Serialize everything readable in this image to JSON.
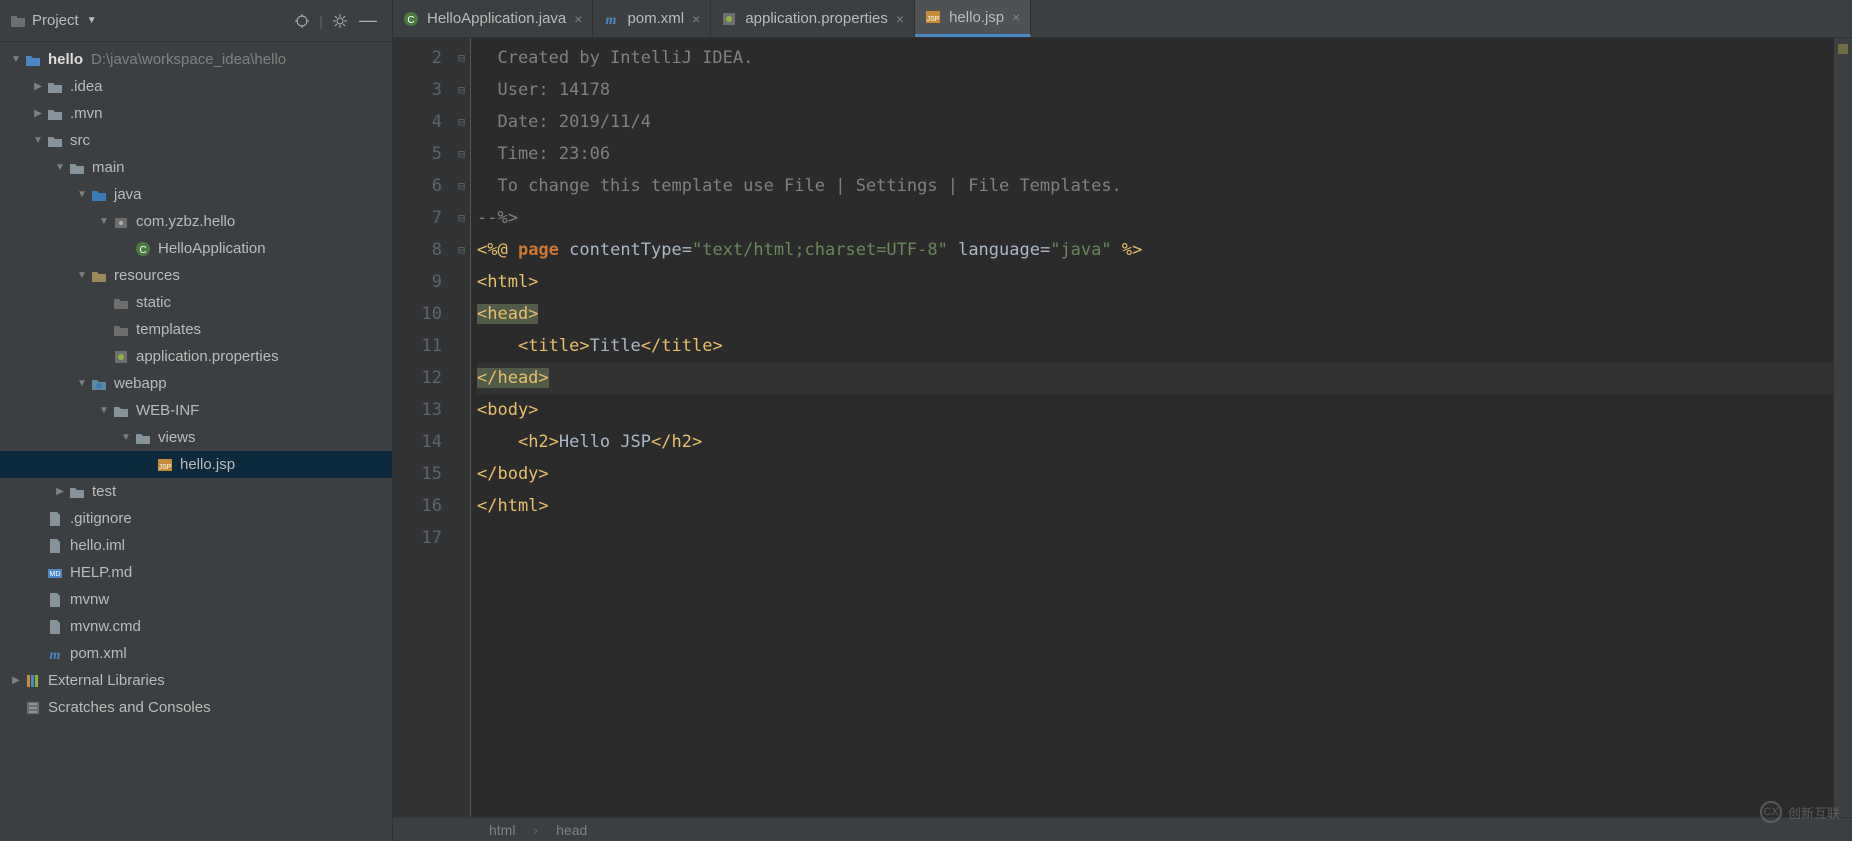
{
  "project": {
    "panel_label": "Project",
    "tree": [
      {
        "depth": 0,
        "arrow": "▼",
        "icon": "folder-blue",
        "label": "hello",
        "path": "D:\\java\\workspace_idea\\hello",
        "bold": true
      },
      {
        "depth": 1,
        "arrow": "▶",
        "icon": "folder",
        "label": ".idea"
      },
      {
        "depth": 1,
        "arrow": "▶",
        "icon": "folder",
        "label": ".mvn"
      },
      {
        "depth": 1,
        "arrow": "▼",
        "icon": "folder",
        "label": "src"
      },
      {
        "depth": 2,
        "arrow": "▼",
        "icon": "folder",
        "label": "main"
      },
      {
        "depth": 3,
        "arrow": "▼",
        "icon": "folder-src",
        "label": "java"
      },
      {
        "depth": 4,
        "arrow": "▼",
        "icon": "package",
        "label": "com.yzbz.hello"
      },
      {
        "depth": 5,
        "arrow": "",
        "icon": "class",
        "label": "HelloApplication"
      },
      {
        "depth": 3,
        "arrow": "▼",
        "icon": "folder-res",
        "label": "resources"
      },
      {
        "depth": 4,
        "arrow": "",
        "icon": "folder-grey",
        "label": "static"
      },
      {
        "depth": 4,
        "arrow": "",
        "icon": "folder-grey",
        "label": "templates"
      },
      {
        "depth": 4,
        "arrow": "",
        "icon": "props",
        "label": "application.properties"
      },
      {
        "depth": 3,
        "arrow": "▼",
        "icon": "folder-web",
        "label": "webapp"
      },
      {
        "depth": 4,
        "arrow": "▼",
        "icon": "folder",
        "label": "WEB-INF"
      },
      {
        "depth": 5,
        "arrow": "▼",
        "icon": "folder",
        "label": "views"
      },
      {
        "depth": 6,
        "arrow": "",
        "icon": "jsp",
        "label": "hello.jsp",
        "selected": true
      },
      {
        "depth": 2,
        "arrow": "▶",
        "icon": "folder",
        "label": "test"
      },
      {
        "depth": 1,
        "arrow": "",
        "icon": "file",
        "label": ".gitignore"
      },
      {
        "depth": 1,
        "arrow": "",
        "icon": "file",
        "label": "hello.iml"
      },
      {
        "depth": 1,
        "arrow": "",
        "icon": "md",
        "label": "HELP.md"
      },
      {
        "depth": 1,
        "arrow": "",
        "icon": "file",
        "label": "mvnw"
      },
      {
        "depth": 1,
        "arrow": "",
        "icon": "file",
        "label": "mvnw.cmd"
      },
      {
        "depth": 1,
        "arrow": "",
        "icon": "maven",
        "label": "pom.xml"
      },
      {
        "depth": 0,
        "arrow": "▶",
        "icon": "libs",
        "label": "External Libraries"
      },
      {
        "depth": 0,
        "arrow": "",
        "icon": "scratch",
        "label": "Scratches and Consoles"
      }
    ]
  },
  "tabs": [
    {
      "icon": "class",
      "label": "HelloApplication.java",
      "active": false
    },
    {
      "icon": "maven",
      "label": "pom.xml",
      "active": false
    },
    {
      "icon": "props",
      "label": "application.properties",
      "active": false
    },
    {
      "icon": "jsp",
      "label": "hello.jsp",
      "active": true
    }
  ],
  "editor": {
    "line_numbers": [
      "2",
      "3",
      "4",
      "5",
      "6",
      "7",
      "8",
      "9",
      "10",
      "11",
      "12",
      "13",
      "14",
      "15",
      "16",
      "17"
    ],
    "fold_marks": [
      "",
      "",
      "",
      "",
      "",
      "⊟",
      "",
      "⊟",
      "⊟",
      "",
      "⊟",
      "⊟",
      "",
      "⊟",
      "⊟",
      ""
    ],
    "lines": [
      [
        {
          "c": "cm",
          "t": "  Created by IntelliJ IDEA."
        }
      ],
      [
        {
          "c": "cm",
          "t": "  User: 14178"
        }
      ],
      [
        {
          "c": "cm",
          "t": "  Date: 2019/11/4"
        }
      ],
      [
        {
          "c": "cm",
          "t": "  Time: 23:06"
        }
      ],
      [
        {
          "c": "cm",
          "t": "  To change this template use File | Settings | File Templates."
        }
      ],
      [
        {
          "c": "cm",
          "t": "--%>"
        }
      ],
      [
        {
          "c": "tag",
          "t": "<%@ "
        },
        {
          "c": "kw",
          "t": "page"
        },
        {
          "c": "txt",
          "t": " contentType="
        },
        {
          "c": "str",
          "t": "\"text/html;charset=UTF-8\""
        },
        {
          "c": "txt",
          "t": " language="
        },
        {
          "c": "str",
          "t": "\"java\""
        },
        {
          "c": "tag",
          "t": " %>"
        }
      ],
      [
        {
          "c": "tag",
          "t": "<html>"
        }
      ],
      [
        {
          "c": "tag-hl",
          "t": "<head>"
        }
      ],
      [
        {
          "c": "txt",
          "t": "    "
        },
        {
          "c": "tag",
          "t": "<title>"
        },
        {
          "c": "txt",
          "t": "Title"
        },
        {
          "c": "tag",
          "t": "</title>"
        }
      ],
      [
        {
          "c": "tag-hl",
          "t": "</head>"
        }
      ],
      [
        {
          "c": "tag",
          "t": "<body>"
        }
      ],
      [
        {
          "c": "txt",
          "t": "    "
        },
        {
          "c": "tag",
          "t": "<h2>"
        },
        {
          "c": "txt",
          "t": "Hello JSP"
        },
        {
          "c": "tag",
          "t": "</h2>"
        }
      ],
      [
        {
          "c": "tag",
          "t": "</body>"
        }
      ],
      [
        {
          "c": "tag",
          "t": "</html>"
        }
      ],
      [
        {
          "c": "txt",
          "t": ""
        }
      ]
    ],
    "current_line_index": 10
  },
  "breadcrumb": [
    "html",
    "head"
  ],
  "watermark": "创新互联"
}
